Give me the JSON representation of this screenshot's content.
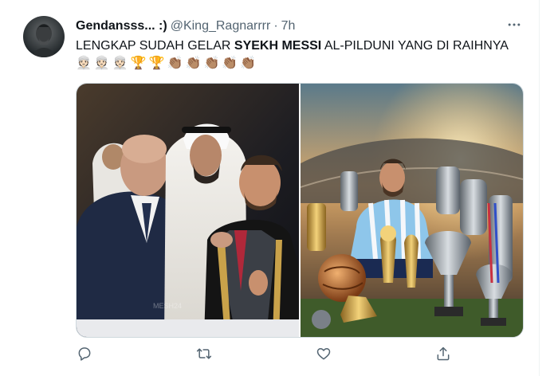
{
  "tweet": {
    "display_name": "Gendansss... :)",
    "handle": "@King_Ragnarrrr",
    "separator": "·",
    "time": "7h",
    "text_before": "LENGKAP SUDAH GELAR ",
    "text_bold": "SYEKH MESSI",
    "text_after": " AL-PILDUNI YANG DI RAIHNYA",
    "emojis": [
      "👳🏻",
      "👳🏻",
      "👳🏻",
      "🏆",
      "🏆",
      "👏🏽",
      "👏🏽",
      "👏🏽",
      "👏🏽",
      "👏🏽"
    ],
    "watermark": "MESH24"
  },
  "icons": {
    "more": "more-icon",
    "reply": "reply-icon",
    "retweet": "retweet-icon",
    "like": "like-icon",
    "share": "share-icon"
  },
  "colors": {
    "text": "#0f1419",
    "secondary": "#536471",
    "border": "#cfd9de"
  }
}
